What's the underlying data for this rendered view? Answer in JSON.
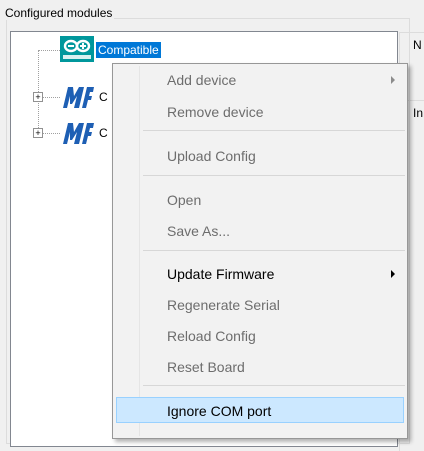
{
  "group": {
    "title": "Configured modules"
  },
  "tree": {
    "nodes": [
      {
        "label": "Compatible",
        "selected": true,
        "icon": "arduino-icon"
      },
      {
        "label": "C",
        "icon": "mf-icon"
      },
      {
        "label": "C",
        "icon": "mf-icon"
      }
    ]
  },
  "right": {
    "label_top": "N",
    "label_mid": "In"
  },
  "menu": {
    "items": [
      {
        "label": "Add device",
        "enabled": false,
        "submenu": true
      },
      {
        "label": "Remove device",
        "enabled": false
      },
      {
        "label": "Upload Config",
        "enabled": false
      },
      {
        "label": "Open",
        "enabled": false
      },
      {
        "label": "Save As...",
        "enabled": false
      },
      {
        "label": "Update Firmware",
        "enabled": true,
        "submenu": true
      },
      {
        "label": "Regenerate Serial",
        "enabled": false
      },
      {
        "label": "Reload Config",
        "enabled": false
      },
      {
        "label": "Reset Board",
        "enabled": false
      },
      {
        "label": "Ignore COM port",
        "enabled": true,
        "hot": true
      }
    ]
  },
  "colors": {
    "selection": "#0078d7",
    "hot_bg": "#cce8ff",
    "hot_border": "#99d1ff"
  }
}
